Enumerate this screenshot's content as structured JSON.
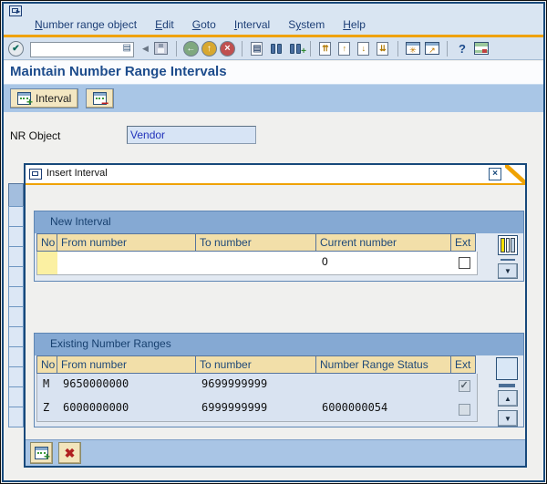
{
  "menu": {
    "items": [
      {
        "pre": "",
        "mnemonic": "N",
        "post": "umber range object"
      },
      {
        "pre": "",
        "mnemonic": "E",
        "post": "dit"
      },
      {
        "pre": "",
        "mnemonic": "G",
        "post": "oto"
      },
      {
        "pre": "",
        "mnemonic": "I",
        "post": "nterval"
      },
      {
        "pre": "S",
        "mnemonic": "y",
        "post": "stem"
      },
      {
        "pre": "",
        "mnemonic": "H",
        "post": "elp"
      }
    ]
  },
  "toolbar": {
    "command_value": "",
    "icons": {
      "enter": "✔",
      "command_menu": "▤",
      "collapse": "◀",
      "back": "←",
      "exit": "↑",
      "cancel": "×",
      "print": "▤",
      "find_plus": "+",
      "first_page": "⇈",
      "prev_page": "↑",
      "next_page": "↓",
      "last_page": "⇊",
      "new_session": "✳",
      "shortcut": "↗",
      "help": "?",
      "dropdown": "▼",
      "scroll_up": "▲",
      "scroll_down": "▼",
      "close": "×",
      "plus": "+",
      "minus": "−",
      "cancel_x": "✖"
    }
  },
  "header": {
    "title": "Maintain Number Range Intervals"
  },
  "app_toolbar": {
    "interval_label": "Interval"
  },
  "form": {
    "nr_object_label": "NR Object",
    "nr_object_value": "Vendor"
  },
  "dialog": {
    "title": "Insert Interval",
    "new_interval": {
      "section_title": "New Interval",
      "columns": [
        "No",
        "From number",
        "To number",
        "Current number",
        "Ext"
      ],
      "row": {
        "no": "",
        "from": "",
        "to": "",
        "current": "0",
        "ext_checked": false
      }
    },
    "existing": {
      "section_title": "Existing Number Ranges",
      "columns": [
        "No",
        "From number",
        "To number",
        "Number Range Status",
        "Ext"
      ],
      "rows": [
        {
          "no": "M",
          "from": "9650000000",
          "to": "9699999999",
          "status": "",
          "ext_checked": true
        },
        {
          "no": "Z",
          "from": "6000000000",
          "to": "6999999999",
          "status": "6000000054",
          "ext_checked": false
        }
      ]
    }
  }
}
